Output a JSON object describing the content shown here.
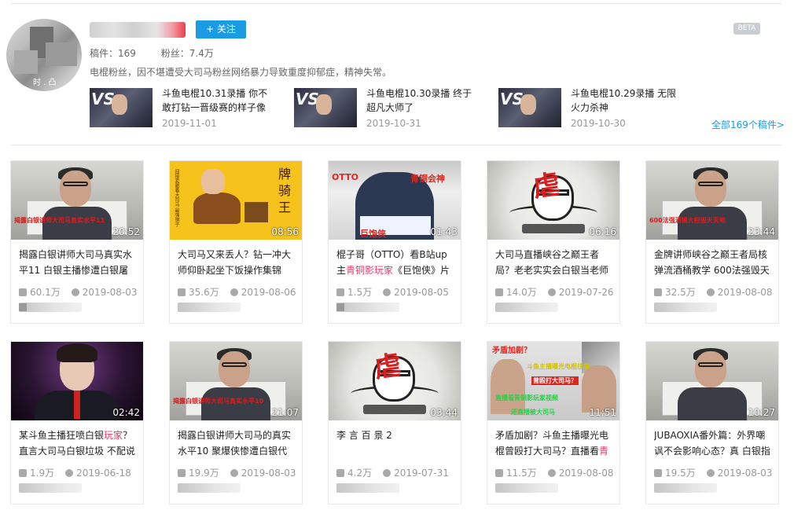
{
  "profile": {
    "follow_label": "+ 关注",
    "beta_label": "BETA",
    "avatar_text": "时 . 凸",
    "works_label": "稿件：",
    "works_count": "169",
    "fans_label": "粉丝：",
    "fans_count": "7.4万",
    "bio": "电棍粉丝，因不堪遭受大司马粉丝网络暴力导致重度抑郁症，精神失常。"
  },
  "recent": [
    {
      "title": "斗鱼电棍10.31录播 你不敢打钻一晋级赛的样子像",
      "date": "2019-11-01",
      "vs": "VS"
    },
    {
      "title": "斗鱼电棍10.30录播 终于超凡大师了",
      "date": "2019-10-31",
      "vs": "VS"
    },
    {
      "title": "斗鱼电棍10.29录播 无限火力杀神",
      "date": "2019-10-30",
      "vs": "VS"
    }
  ],
  "all_link": "全部169个稿件>",
  "cards": [
    {
      "title": "揭露白银讲师大司马真实水平11 白银主播惨遭白银屠",
      "duration": "20:52",
      "views": "60.1万",
      "date": "2019-08-03",
      "cover_text": "揭露白银讲师大司马真实水平11"
    },
    {
      "title": "大司马又来丢人？钻一冲大师仰卧起坐下饭操作集锦",
      "duration": "08:56",
      "views": "35.6万",
      "date": "2019-08-06",
      "cover_text": "牌 骑 王"
    },
    {
      "title_pre": "棍子哥（OTTO）看B站up主",
      "title_hl": "青铜影玩家",
      "title_post": "《巨饱侠》片",
      "duration": "01:43",
      "views": "1.5万",
      "date": "2019-08-05",
      "cover_t1": "OTTO",
      "cover_t2": "青铜会神",
      "cover_t3": "巨饱侠"
    },
    {
      "title": "大司马直播峡谷之巅王者局？老老实实会白银当老师",
      "duration": "06:16",
      "views": "14.0万",
      "date": "2019-07-26",
      "cover_text": "虐"
    },
    {
      "title": "金牌讲师峡谷之巅王者局核弹流酒桶教学 600法强毁天",
      "duration": "23:44",
      "views": "32.5万",
      "date": "2019-08-08",
      "cover_text": "600法强酒桶大招毁天灭地"
    },
    {
      "title_pre": "某斗鱼主播狂喷白银",
      "title_hl": "玩家",
      "title_post": "？直言大司马白银垃圾 不配说",
      "duration": "02:42",
      "views": "1.9万",
      "date": "2019-06-18"
    },
    {
      "title": "揭露白银讲师大司马的真实水平10 聚爆侠惨遭白银代",
      "duration": "21:07",
      "views": "19.9万",
      "date": "2019-08-03",
      "cover_text": "揭露白银讲师大司马真实水平10"
    },
    {
      "title": "李 言 百 景 2",
      "duration": "03:44",
      "views": "4.2万",
      "date": "2019-07-31",
      "cover_text": "虐"
    },
    {
      "title_pre": "矛盾加剧？斗鱼主播曝光电棍曾殴打大司马？直播看",
      "title_hl": "青",
      "title_post": "",
      "duration": "11:51",
      "views": "11.5万",
      "date": "2019-08-08",
      "cover_t1": "矛盾加剧？",
      "cover_t2": "斗鱼主播曝光电棍往事",
      "cover_t3": "曾殴打大司马？",
      "cover_t4": "直播看青铜影玩家视频",
      "cover_t5": "还直播被大司马"
    },
    {
      "title": "JUBAOXIA番外篇：外界嘲讽不会影响心态？真 白银指",
      "duration": "10:27",
      "views": "19.5万",
      "date": "2019-08-03"
    }
  ],
  "colors": {
    "accent": "#1a9be4",
    "highlight": "#e6396a"
  }
}
